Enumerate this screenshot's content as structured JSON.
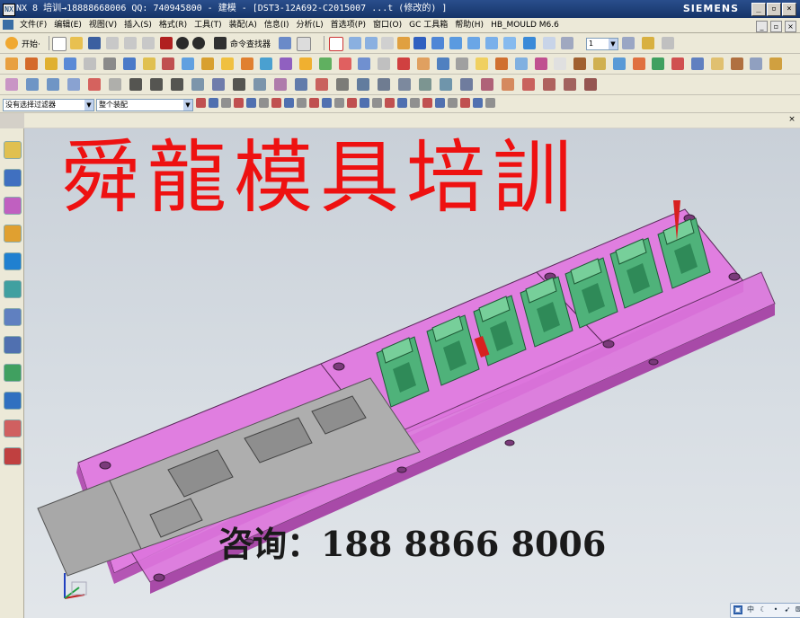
{
  "window": {
    "app_icon": "NX",
    "title": "NX 8 培训→18888668006 QQ: 740945800 - 建模 - [DST3-12A692-C2015007 ...t (修改的) ]",
    "brand": "SIEMENS",
    "controls": [
      "_",
      "▫",
      "×"
    ]
  },
  "menu": {
    "items": [
      "文件(F)",
      "编辑(E)",
      "视图(V)",
      "插入(S)",
      "格式(R)",
      "工具(T)",
      "装配(A)",
      "信息(I)",
      "分析(L)",
      "首选项(P)",
      "窗口(O)",
      "GC 工具箱",
      "帮助(H)",
      "HB_MOULD M6.6"
    ]
  },
  "toolbar1": {
    "start_label": "开始·",
    "command_finder_label": "命令查找器",
    "layer_value": "1"
  },
  "selection_bar": {
    "filter_value": "没有选择过滤器",
    "scope_value": "整个装配"
  },
  "overlay": {
    "banner": "舜龍模具培訓",
    "contact": "咨询：188 8866 8006"
  },
  "colors": {
    "plate": "#e07ee0",
    "plate_dark": "#b455b4",
    "strip": "#a8a8a8",
    "die_green": "#4fb27a",
    "banner_red": "#ee1111",
    "titlebar": "#163468"
  },
  "view_toolbar": {
    "icons": [
      "view-icon",
      "zhong-icon",
      "moon-icon",
      "dot-icon",
      "arrow-icon",
      "keyboard-icon",
      "grid-icon"
    ],
    "zhong_label": "中"
  }
}
